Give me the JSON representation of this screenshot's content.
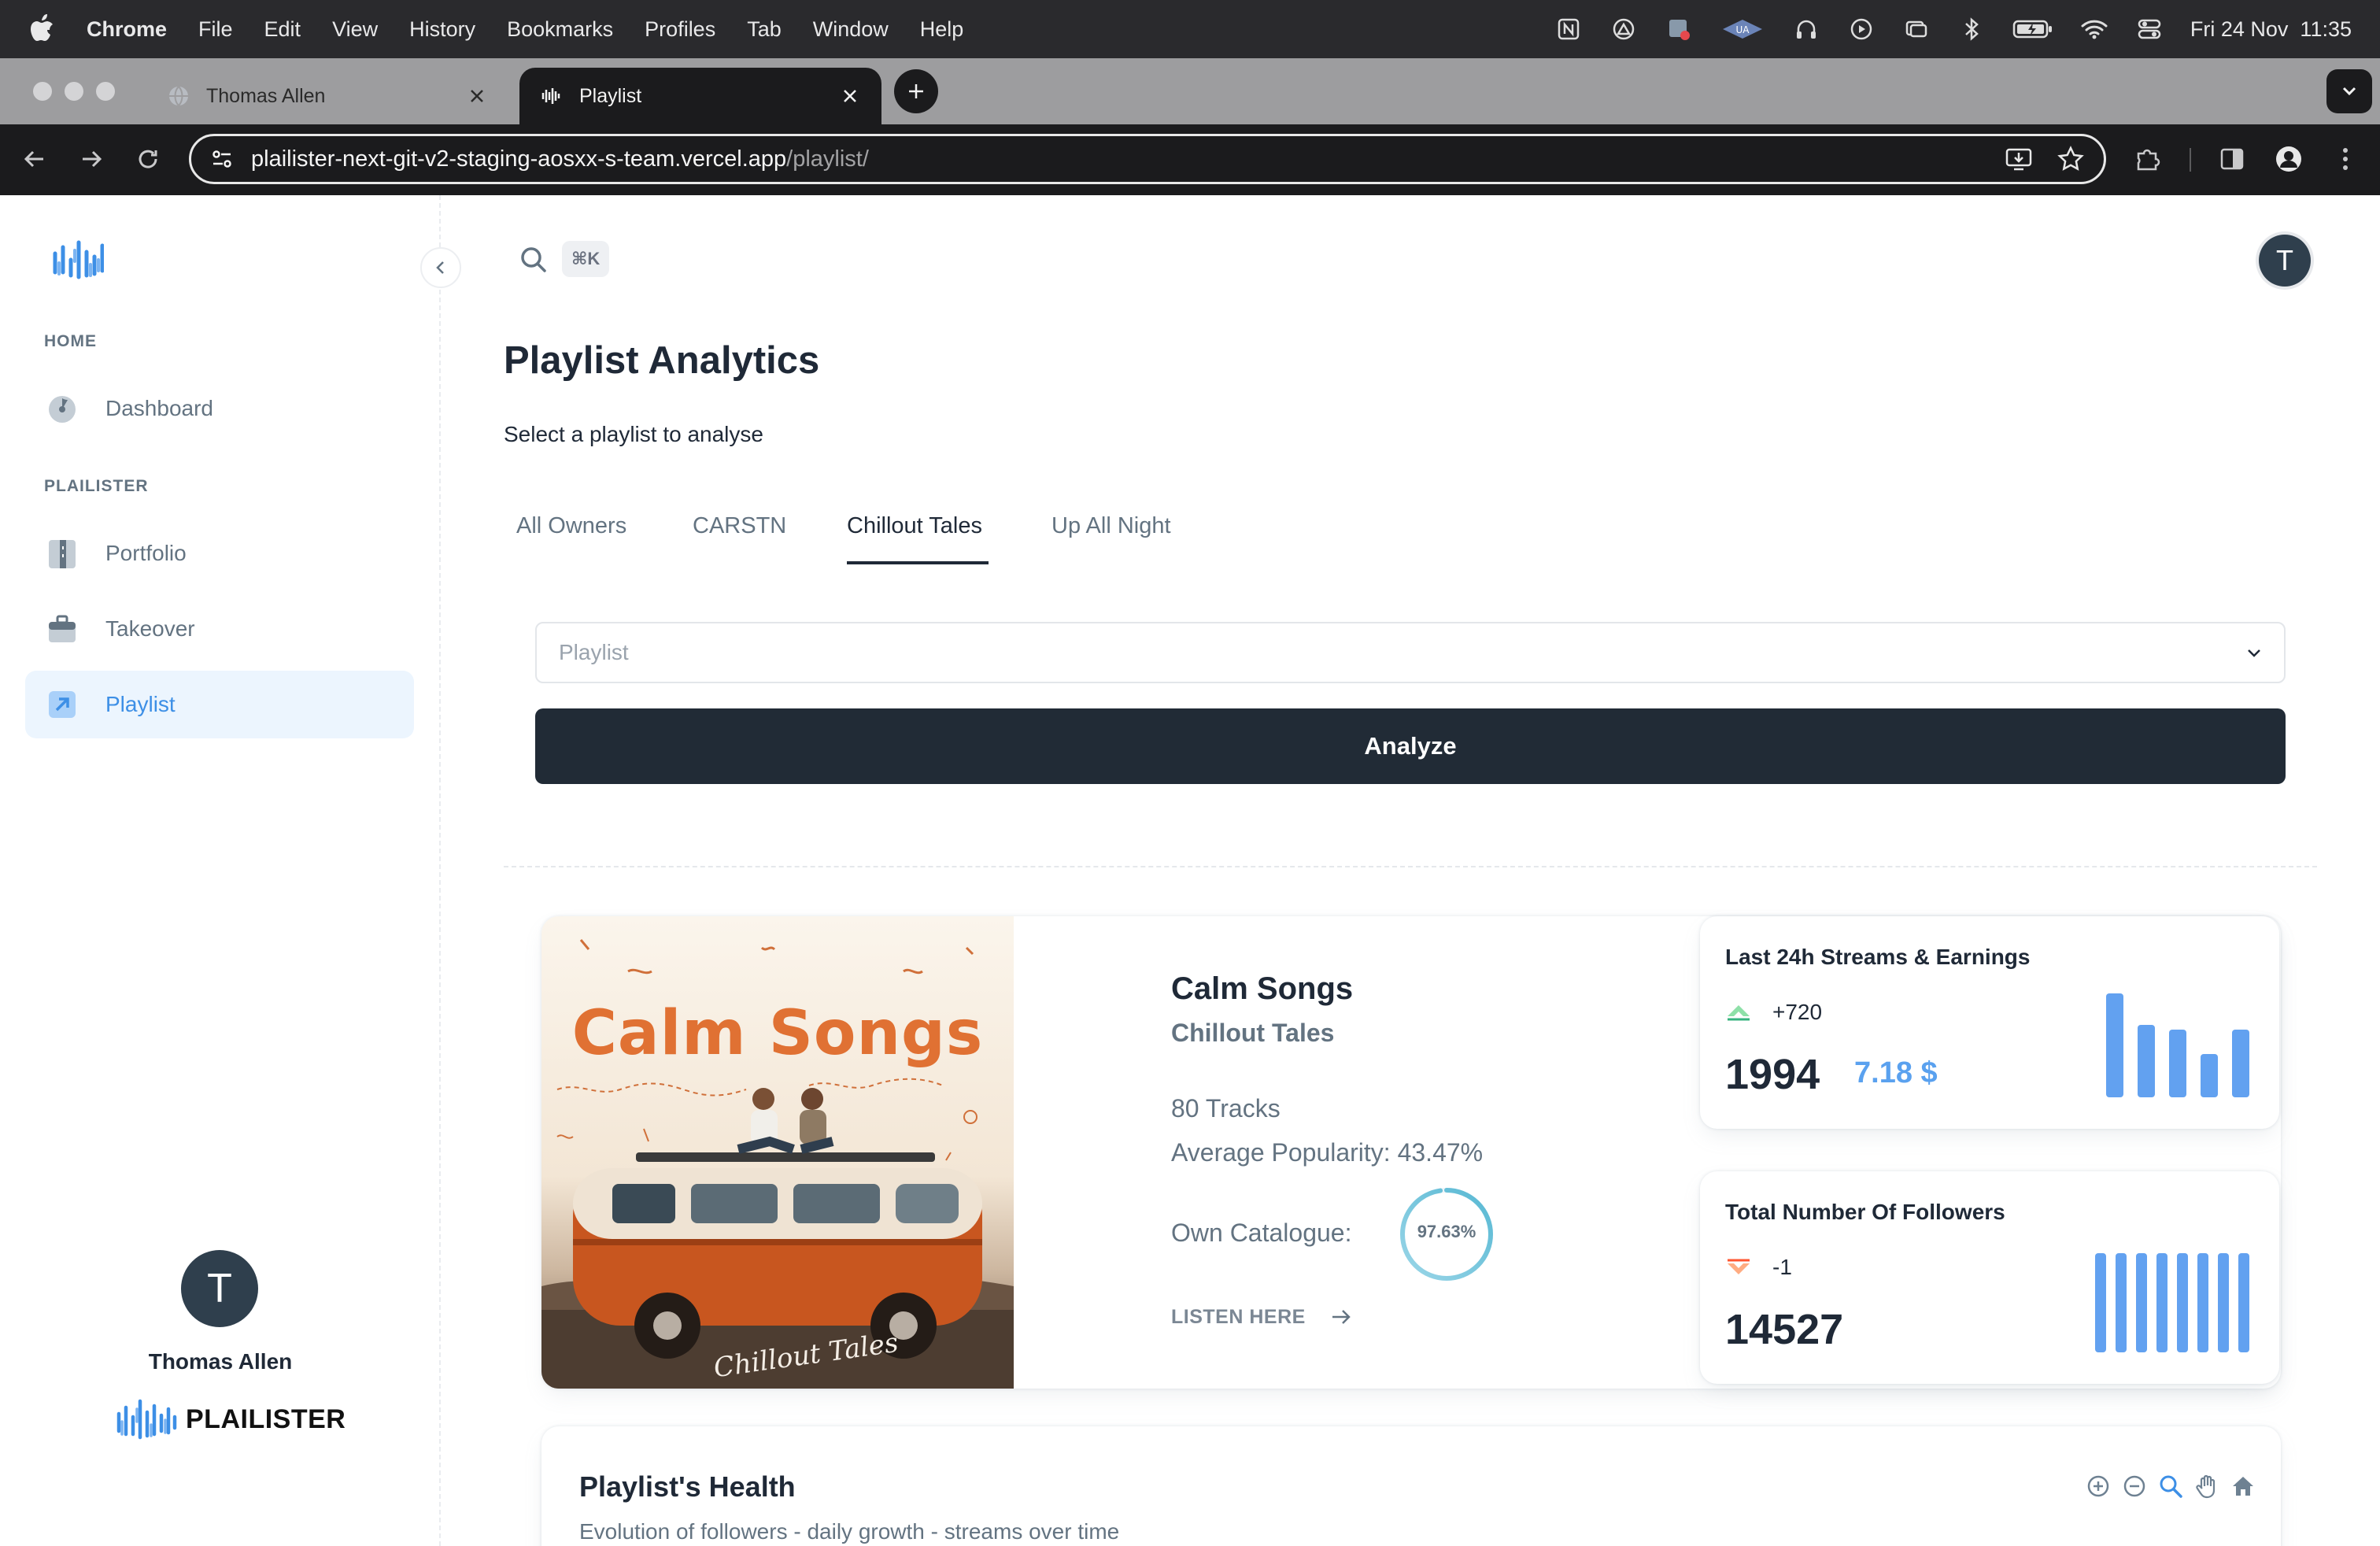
{
  "menubar": {
    "app": "Chrome",
    "items": [
      "File",
      "Edit",
      "View",
      "History",
      "Bookmarks",
      "Profiles",
      "Tab",
      "Window",
      "Help"
    ],
    "clock": "Fri 24 Nov  11:35"
  },
  "browser": {
    "tabs": [
      {
        "title": "Thomas Allen",
        "active": false
      },
      {
        "title": "Playlist",
        "active": true
      }
    ],
    "url_host": "plailister-next-git-v2-staging-aosxx-s-team.vercel.app",
    "url_path": "/playlist/"
  },
  "sidebar": {
    "sections": [
      {
        "label": "HOME",
        "items": [
          {
            "label": "Dashboard",
            "icon": "dashboard-icon",
            "active": false
          }
        ]
      },
      {
        "label": "PLAILISTER",
        "items": [
          {
            "label": "Portfolio",
            "icon": "portfolio-icon",
            "active": false
          },
          {
            "label": "Takeover",
            "icon": "takeover-icon",
            "active": false
          },
          {
            "label": "Playlist",
            "icon": "playlist-icon",
            "active": true
          }
        ]
      }
    ],
    "user": {
      "initial": "T",
      "name": "Thomas Allen"
    },
    "brand": "PLAILISTER"
  },
  "header": {
    "shortcut": "⌘K",
    "avatar_initial": "T"
  },
  "page": {
    "title": "Playlist Analytics",
    "subtitle": "Select a playlist to analyse",
    "owner_tabs": [
      "All Owners",
      "CARSTN",
      "Chillout Tales",
      "Up All Night"
    ],
    "active_owner_tab": "Chillout Tales",
    "select_placeholder": "Playlist",
    "analyze_label": "Analyze"
  },
  "playlist": {
    "cover_title": "Calm Songs",
    "cover_script": "Chillout Tales",
    "name": "Calm Songs",
    "owner": "Chillout Tales",
    "tracks": "80 Tracks",
    "popularity": "Average Popularity: 43.47%",
    "own_catalogue_label": "Own Catalogue:",
    "own_catalogue_value": "97.63%",
    "own_catalogue_fraction": 0.9763,
    "listen_label": "LISTEN HERE"
  },
  "stats": {
    "streams": {
      "title": "Last 24h Streams & Earnings",
      "delta": "+720",
      "value": "1994",
      "earnings": "7.18 $",
      "bars": [
        1.0,
        0.7,
        0.65,
        0.42,
        0.65
      ]
    },
    "followers": {
      "title": "Total Number Of Followers",
      "delta": "-1",
      "value": "14527",
      "bars": [
        1.0,
        1.0,
        1.0,
        1.0,
        1.0,
        1.0,
        1.0,
        1.0
      ]
    }
  },
  "health": {
    "title": "Playlist's Health",
    "subtitle": "Evolution of followers - daily growth - streams over time",
    "tools": [
      "zoom-in-icon",
      "zoom-out-icon",
      "magnify-icon",
      "pan-hand-icon",
      "home-icon"
    ]
  },
  "colors": {
    "accent": "#3d8fe6",
    "bar": "#62a1f0",
    "dark_button": "#212b36",
    "up": "#36b37e",
    "down": "#ff5630"
  }
}
